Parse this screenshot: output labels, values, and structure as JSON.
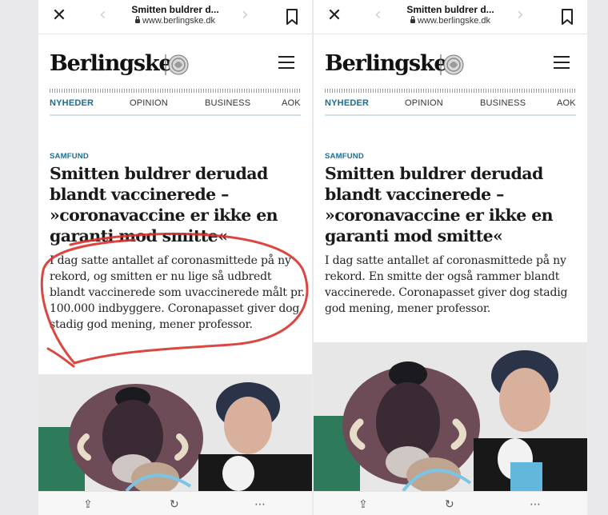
{
  "browser": {
    "page_title": "Smitten buldrer d...",
    "url": "www.berlingske.dk"
  },
  "site": {
    "brand": "Berlingske",
    "nav": [
      "NYHEDER",
      "OPINION",
      "BUSINESS",
      "AOK"
    ],
    "active_nav": "NYHEDER",
    "accent_color": "#1a6e96"
  },
  "article": {
    "kicker": "SAMFUND",
    "headline": "Smitten buldrer derudad blandt vaccinerede – »coronavaccine er ikke en garanti mod smitte«"
  },
  "panels": {
    "left": {
      "lead": "I dag satte antallet af coronasmittede på ny rekord, og smitten er nu lige så udbredt blandt vaccinerede som uvaccinerede målt pr. 100.000 indbyggere. Coronapasset giver dog stadig god mening, mener professor.",
      "annotation_color": "#d9322b"
    },
    "right": {
      "lead": "I dag satte antallet af coronasmittede på ny rekord. En smitte der også rammer blandt vaccinerede. Coronapasset giver dog stadig god mening, mener professor."
    }
  },
  "icons": {
    "close": "close-icon",
    "bookmark": "bookmark-icon",
    "menu": "menu-icon",
    "share": "share-icon",
    "refresh": "refresh-icon",
    "more": "more-icon"
  }
}
